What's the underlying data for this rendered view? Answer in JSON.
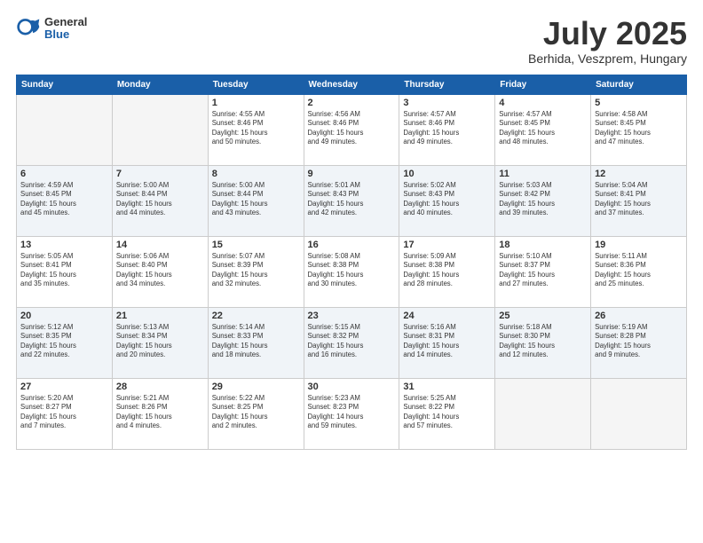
{
  "header": {
    "logo": {
      "general": "General",
      "blue": "Blue"
    },
    "title": "July 2025",
    "location": "Berhida, Veszprem, Hungary"
  },
  "weekdays": [
    "Sunday",
    "Monday",
    "Tuesday",
    "Wednesday",
    "Thursday",
    "Friday",
    "Saturday"
  ],
  "weeks": [
    [
      {
        "day": "",
        "info": ""
      },
      {
        "day": "",
        "info": ""
      },
      {
        "day": "1",
        "info": "Sunrise: 4:55 AM\nSunset: 8:46 PM\nDaylight: 15 hours\nand 50 minutes."
      },
      {
        "day": "2",
        "info": "Sunrise: 4:56 AM\nSunset: 8:46 PM\nDaylight: 15 hours\nand 49 minutes."
      },
      {
        "day": "3",
        "info": "Sunrise: 4:57 AM\nSunset: 8:46 PM\nDaylight: 15 hours\nand 49 minutes."
      },
      {
        "day": "4",
        "info": "Sunrise: 4:57 AM\nSunset: 8:45 PM\nDaylight: 15 hours\nand 48 minutes."
      },
      {
        "day": "5",
        "info": "Sunrise: 4:58 AM\nSunset: 8:45 PM\nDaylight: 15 hours\nand 47 minutes."
      }
    ],
    [
      {
        "day": "6",
        "info": "Sunrise: 4:59 AM\nSunset: 8:45 PM\nDaylight: 15 hours\nand 45 minutes."
      },
      {
        "day": "7",
        "info": "Sunrise: 5:00 AM\nSunset: 8:44 PM\nDaylight: 15 hours\nand 44 minutes."
      },
      {
        "day": "8",
        "info": "Sunrise: 5:00 AM\nSunset: 8:44 PM\nDaylight: 15 hours\nand 43 minutes."
      },
      {
        "day": "9",
        "info": "Sunrise: 5:01 AM\nSunset: 8:43 PM\nDaylight: 15 hours\nand 42 minutes."
      },
      {
        "day": "10",
        "info": "Sunrise: 5:02 AM\nSunset: 8:43 PM\nDaylight: 15 hours\nand 40 minutes."
      },
      {
        "day": "11",
        "info": "Sunrise: 5:03 AM\nSunset: 8:42 PM\nDaylight: 15 hours\nand 39 minutes."
      },
      {
        "day": "12",
        "info": "Sunrise: 5:04 AM\nSunset: 8:41 PM\nDaylight: 15 hours\nand 37 minutes."
      }
    ],
    [
      {
        "day": "13",
        "info": "Sunrise: 5:05 AM\nSunset: 8:41 PM\nDaylight: 15 hours\nand 35 minutes."
      },
      {
        "day": "14",
        "info": "Sunrise: 5:06 AM\nSunset: 8:40 PM\nDaylight: 15 hours\nand 34 minutes."
      },
      {
        "day": "15",
        "info": "Sunrise: 5:07 AM\nSunset: 8:39 PM\nDaylight: 15 hours\nand 32 minutes."
      },
      {
        "day": "16",
        "info": "Sunrise: 5:08 AM\nSunset: 8:38 PM\nDaylight: 15 hours\nand 30 minutes."
      },
      {
        "day": "17",
        "info": "Sunrise: 5:09 AM\nSunset: 8:38 PM\nDaylight: 15 hours\nand 28 minutes."
      },
      {
        "day": "18",
        "info": "Sunrise: 5:10 AM\nSunset: 8:37 PM\nDaylight: 15 hours\nand 27 minutes."
      },
      {
        "day": "19",
        "info": "Sunrise: 5:11 AM\nSunset: 8:36 PM\nDaylight: 15 hours\nand 25 minutes."
      }
    ],
    [
      {
        "day": "20",
        "info": "Sunrise: 5:12 AM\nSunset: 8:35 PM\nDaylight: 15 hours\nand 22 minutes."
      },
      {
        "day": "21",
        "info": "Sunrise: 5:13 AM\nSunset: 8:34 PM\nDaylight: 15 hours\nand 20 minutes."
      },
      {
        "day": "22",
        "info": "Sunrise: 5:14 AM\nSunset: 8:33 PM\nDaylight: 15 hours\nand 18 minutes."
      },
      {
        "day": "23",
        "info": "Sunrise: 5:15 AM\nSunset: 8:32 PM\nDaylight: 15 hours\nand 16 minutes."
      },
      {
        "day": "24",
        "info": "Sunrise: 5:16 AM\nSunset: 8:31 PM\nDaylight: 15 hours\nand 14 minutes."
      },
      {
        "day": "25",
        "info": "Sunrise: 5:18 AM\nSunset: 8:30 PM\nDaylight: 15 hours\nand 12 minutes."
      },
      {
        "day": "26",
        "info": "Sunrise: 5:19 AM\nSunset: 8:28 PM\nDaylight: 15 hours\nand 9 minutes."
      }
    ],
    [
      {
        "day": "27",
        "info": "Sunrise: 5:20 AM\nSunset: 8:27 PM\nDaylight: 15 hours\nand 7 minutes."
      },
      {
        "day": "28",
        "info": "Sunrise: 5:21 AM\nSunset: 8:26 PM\nDaylight: 15 hours\nand 4 minutes."
      },
      {
        "day": "29",
        "info": "Sunrise: 5:22 AM\nSunset: 8:25 PM\nDaylight: 15 hours\nand 2 minutes."
      },
      {
        "day": "30",
        "info": "Sunrise: 5:23 AM\nSunset: 8:23 PM\nDaylight: 14 hours\nand 59 minutes."
      },
      {
        "day": "31",
        "info": "Sunrise: 5:25 AM\nSunset: 8:22 PM\nDaylight: 14 hours\nand 57 minutes."
      },
      {
        "day": "",
        "info": ""
      },
      {
        "day": "",
        "info": ""
      }
    ]
  ]
}
